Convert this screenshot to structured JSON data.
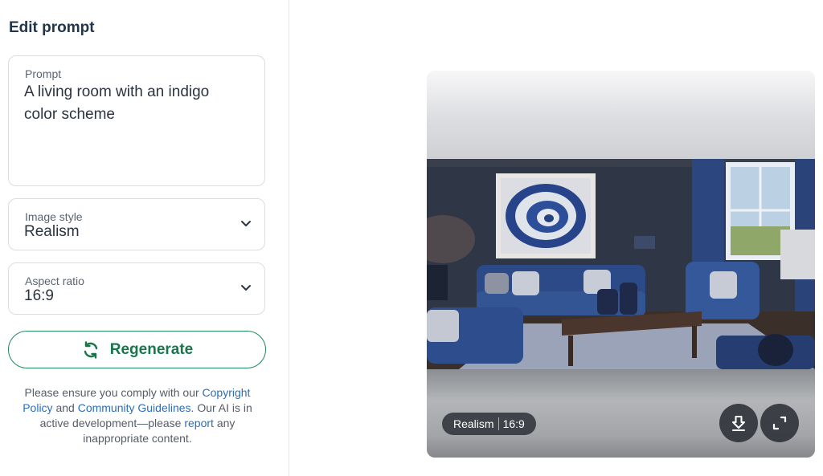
{
  "panel": {
    "title": "Edit prompt"
  },
  "prompt": {
    "label": "Prompt",
    "value": "A living room with an indigo color scheme"
  },
  "image_style": {
    "label": "Image style",
    "value": "Realism"
  },
  "aspect_ratio": {
    "label": "Aspect ratio",
    "value": "16:9"
  },
  "regenerate": {
    "label": "Regenerate"
  },
  "notice": {
    "part1": "Please ensure you comply with our ",
    "copyright_link": "Copyright Policy",
    "part2": " and ",
    "guidelines_link": "Community Guidelines",
    "part3": ". Our AI is in active development—please ",
    "report_link": "report",
    "part4": " any inappropriate content."
  },
  "preview": {
    "badge_style": "Realism",
    "badge_ratio": "16:9",
    "icons": {
      "download": "download-icon",
      "fullscreen": "fullscreen-icon"
    }
  },
  "colors": {
    "accent": "#18764b",
    "link": "#2a6ebd",
    "indigo": "#2f4a85"
  }
}
